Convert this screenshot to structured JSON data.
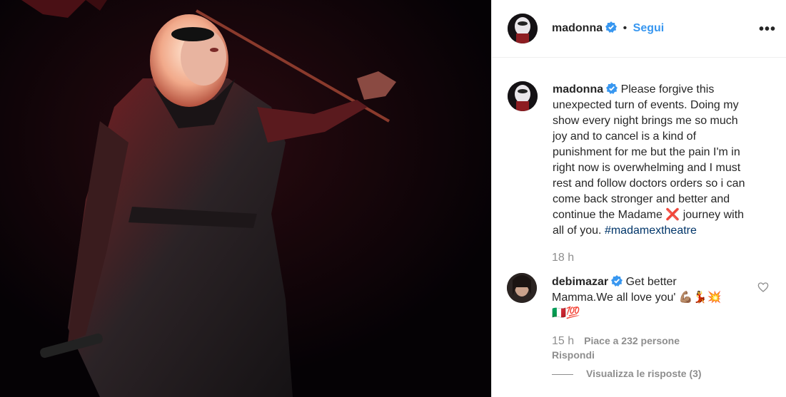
{
  "post": {
    "author": "madonna",
    "follow_label": "Segui",
    "dot": "•",
    "more_label": "•••"
  },
  "caption": {
    "username": "madonna",
    "text_before": "Please forgive this\nunexpected turn of events. Doing my\nshow every night brings me so much\njoy and to cancel is a kind of\npunishment for me but the pain I'm in\nright now is overwhelming and I must\nrest and follow doctors orders so i can\ncome back stronger and better and\ncontinue the Madame ",
    "x_emoji": "❌",
    "text_after": " journey with\nall of you. ",
    "hashtag": "#madamextheatre",
    "time": "18 h"
  },
  "comment": {
    "username": "debimazar",
    "text": "Get better\nMamma.We all love you' 💪🏽💃💥\n🇮🇹💯",
    "time": "15 h",
    "likes": "Piace a 232 persone",
    "reply_label": "Rispondi",
    "view_replies_label": "Visualizza le risposte (3)"
  },
  "colors": {
    "link_blue": "#3897f0",
    "hashtag": "#003569",
    "muted": "#8e8e8e",
    "verified_blue": "#3897f0"
  }
}
